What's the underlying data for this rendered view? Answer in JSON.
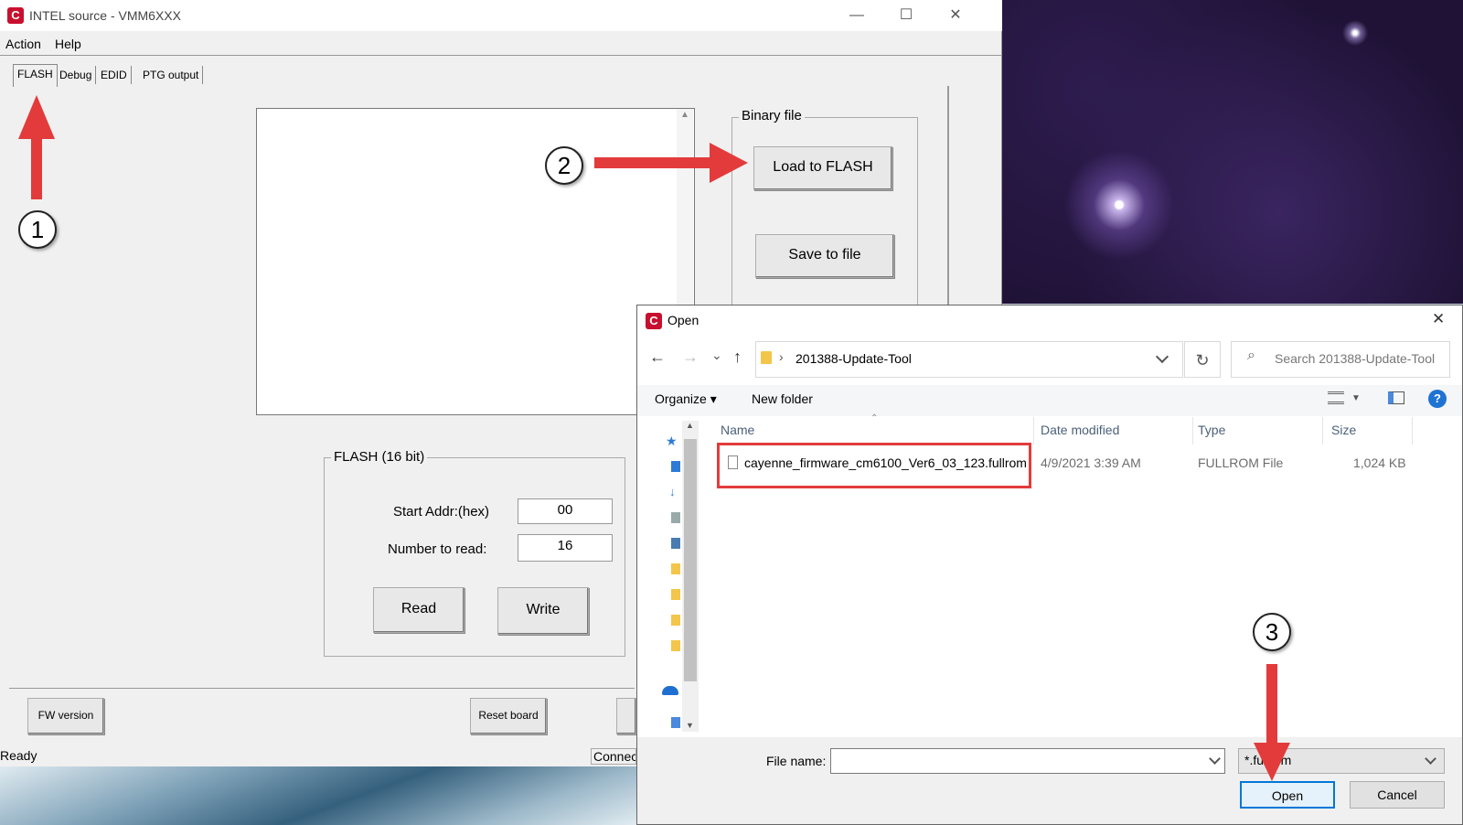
{
  "app": {
    "title": "INTEL source - VMM6XXX",
    "caption_buttons": {
      "minimize": "—",
      "maximize": "☐",
      "close": "✕"
    },
    "menu": [
      "Action",
      "Help"
    ],
    "tabs": [
      "FLASH",
      "Debug",
      "EDID",
      "PTG output"
    ],
    "binary_group": {
      "label": "Binary file",
      "load_button": "Load to FLASH",
      "save_button": "Save to file"
    },
    "flash_group": {
      "label": "FLASH (16 bit)",
      "start_addr_label": "Start Addr:(hex)",
      "start_addr_value": "00",
      "number_label": "Number to read:",
      "number_value": "16",
      "read_button": "Read",
      "write_button": "Write"
    },
    "bottom_buttons": {
      "fw_version": "FW version",
      "reset_board": "Reset board"
    },
    "status": {
      "left": "Ready",
      "right": "Connec"
    }
  },
  "dialog": {
    "title": "Open",
    "close": "✕",
    "nav": {
      "back": "←",
      "forward": "→",
      "recent": "⌄",
      "up": "↑"
    },
    "breadcrumb_separator": "›",
    "path": "201388-Update-Tool",
    "search_placeholder": "Search 201388-Update-Tool",
    "toolbar": {
      "organize": "Organize ▾",
      "new_folder": "New folder",
      "help": "?"
    },
    "columns": [
      "Name",
      "Date modified",
      "Type",
      "Size"
    ],
    "files": [
      {
        "name": "cayenne_firmware_cm6100_Ver6_03_123.fullrom",
        "date": "4/9/2021 3:39 AM",
        "type": "FULLROM File",
        "size": "1,024 KB"
      }
    ],
    "file_name_label": "File name:",
    "file_name_value": "",
    "filter_value": "*.fullrom",
    "open_button": "Open",
    "cancel_button": "Cancel"
  },
  "annotations": {
    "step1": "1",
    "step2": "2",
    "step3": "3",
    "accent_color": "#e33b3b"
  }
}
